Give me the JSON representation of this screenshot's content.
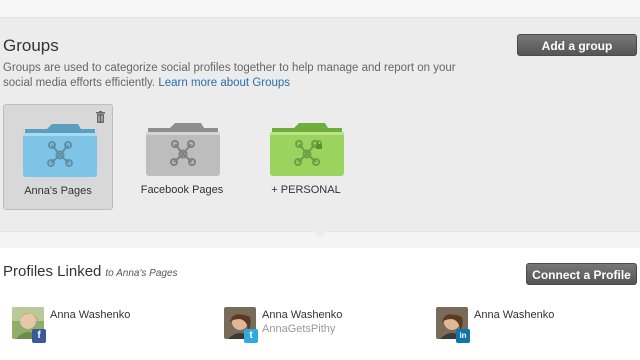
{
  "groups": {
    "title": "Groups",
    "description": "Groups are used to categorize social profiles together to help manage and report on your social media efforts efficiently.",
    "learn_more": "Learn more about Groups",
    "add_button": "Add a group",
    "items": [
      {
        "label": "Anna's Pages",
        "color": "#7ec4e6",
        "selected": true,
        "icon": "trash-icon"
      },
      {
        "label": "Facebook Pages",
        "color": "#bdbdbd",
        "selected": false
      },
      {
        "label": "+ PERSONAL",
        "color": "#9bd35f",
        "selected": false,
        "icon": "lock-icon"
      }
    ]
  },
  "profiles": {
    "title": "Profiles Linked",
    "subtitle": "to Anna's Pages",
    "connect_button": "Connect a Profile",
    "items": [
      {
        "name": "Anna Washenko",
        "handle": "",
        "network": "facebook",
        "badge": "f",
        "badge_color": "#3b5998"
      },
      {
        "name": "Anna Washenko",
        "handle": "AnnaGetsPithy",
        "network": "twitter",
        "badge": "t",
        "badge_color": "#2fa9e0"
      },
      {
        "name": "Anna Washenko",
        "handle": "",
        "network": "linkedin",
        "badge": "in",
        "badge_color": "#0e76a8"
      }
    ]
  }
}
